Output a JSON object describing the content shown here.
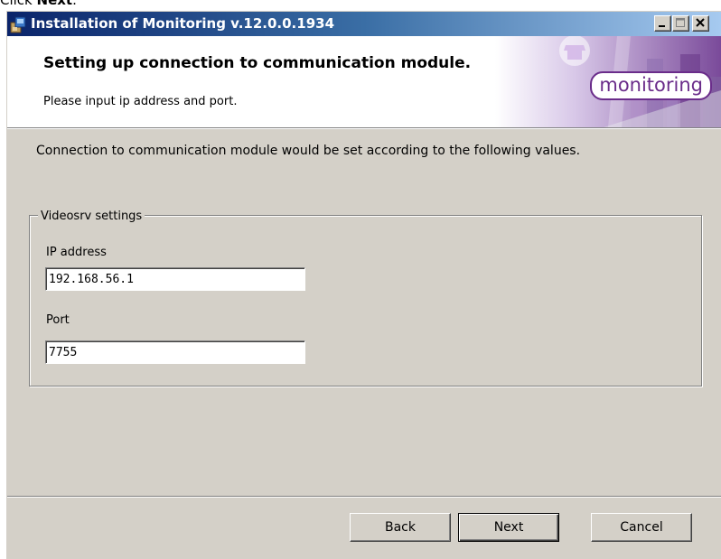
{
  "caption": {
    "prefix": "Click ",
    "bold": "Next",
    "suffix": "."
  },
  "window": {
    "title": "Installation of Monitoring v.12.0.0.1934"
  },
  "header": {
    "title": "Setting up connection to communication module.",
    "subtitle": "Please input ip address and port.",
    "logo": "monitoring"
  },
  "description": "Connection to communication module would be set according to the following values.",
  "group": {
    "legend": "Videosrv settings",
    "ip_label": "IP address",
    "ip_value": "192.168.56.1",
    "port_label": "Port",
    "port_value": "7755"
  },
  "buttons": {
    "back": "Back",
    "next": "Next",
    "cancel": "Cancel"
  },
  "colors": {
    "logo": "#6a2c8a",
    "title_bar": "#0a246a"
  }
}
